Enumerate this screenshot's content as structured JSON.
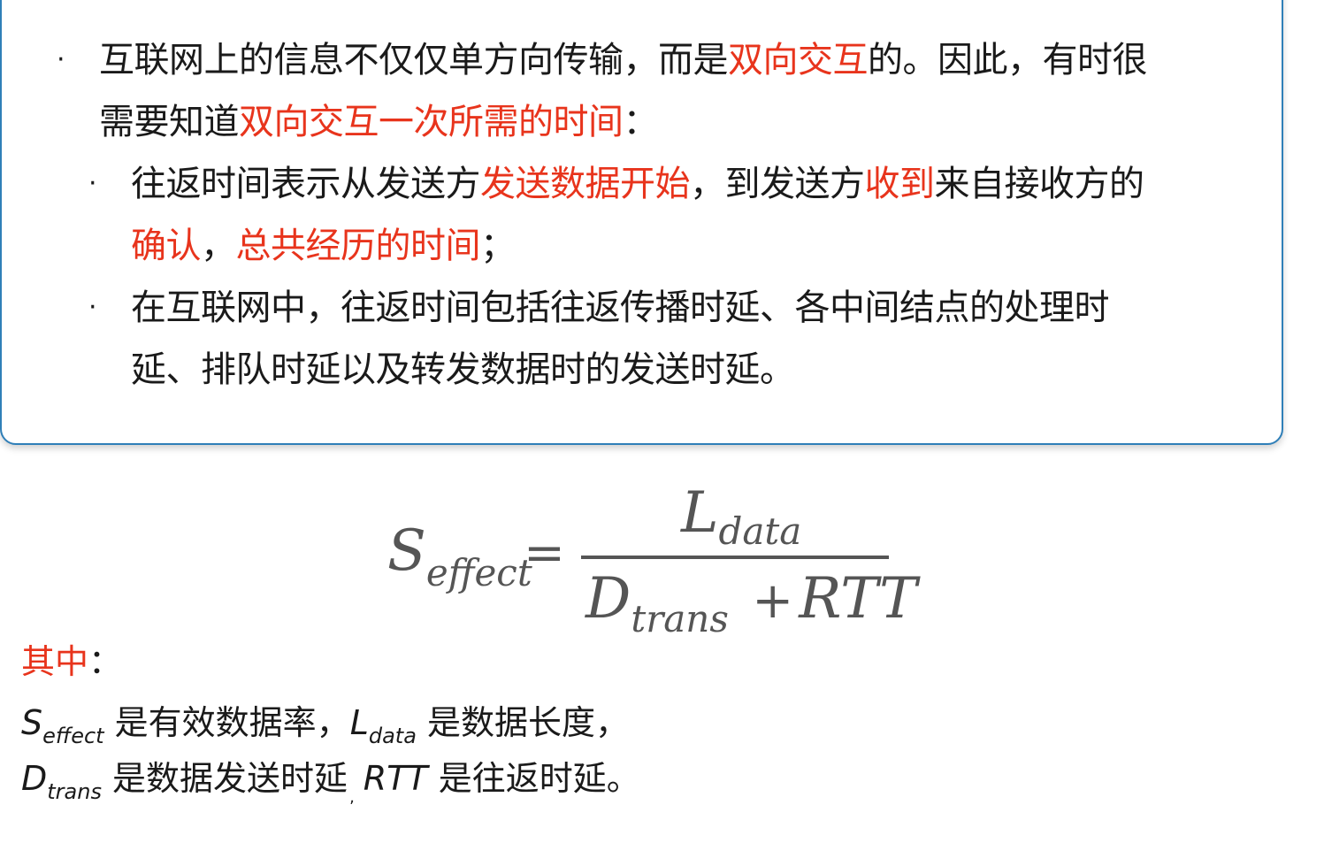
{
  "panel": {
    "bullet1": {
      "part1": "互联网上的信息不仅仅单方向传输，而是",
      "part2_red": "双向交互",
      "part3": "的。因此，有时很",
      "line2_part1": "需要知道",
      "line2_part2_red": "双向交互一次所需的时间",
      "line2_part3": "："
    },
    "sub1": {
      "part1": "往返时间表示从发送方",
      "part2_red": "发送数据开始",
      "part3": "，到发送方",
      "part4_red": "收到",
      "part5": "来自接收方的",
      "line2_part1_red": "确认",
      "line2_part2": "，",
      "line2_part3_red": "总共经历的时间",
      "line2_part4": "；"
    },
    "sub2": {
      "line1": "在互联网中，往返时间包括往返传播时延、各中间结点的处理时",
      "line2": "延、排队时延以及转发数据时的发送时延。"
    },
    "bullet_char": "·"
  },
  "formula": {
    "lhs_main": "S",
    "lhs_sub": "effect",
    "equals": "=",
    "num_main": "L",
    "num_sub": "data",
    "den_main": "D",
    "den_sub": "trans",
    "den_plus": "+",
    "den_rtt": "RTT"
  },
  "legend": {
    "title_red": "其中",
    "title_colon": "：",
    "line1": {
      "var1_main": "S",
      "var1_sub": "effect",
      "text1": " 是有效数据率，",
      "var2_main": "L",
      "var2_sub": "data",
      "text2": " 是数据长度，"
    },
    "line2": {
      "var1_main": "D",
      "var1_sub": "trans",
      "text1": " 是数据发送时延",
      "comma": ",",
      "var2": "RTT",
      "text2": " 是往返时延。"
    }
  }
}
